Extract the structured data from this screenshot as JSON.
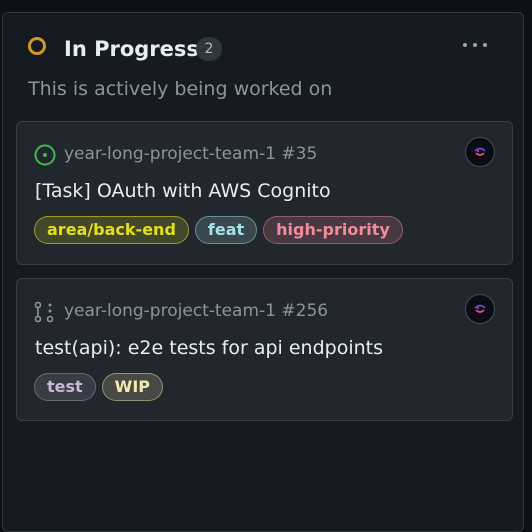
{
  "column": {
    "title": "In Progress",
    "count": "2",
    "description": "This is actively being worked on",
    "status_color": "#d29922"
  },
  "cards": [
    {
      "repo": "year-long-project-team-1 #35",
      "title": "[Task] OAuth with AWS Cognito",
      "type_icon": "issue-open-icon",
      "labels": [
        {
          "text": "area/back-end",
          "color": "#e3e11a"
        },
        {
          "text": "feat",
          "color": "#a6e2e9"
        },
        {
          "text": "high-priority",
          "color": "#f28b9c"
        }
      ]
    },
    {
      "repo": "year-long-project-team-1 #256",
      "title": "test(api): e2e tests for api endpoints",
      "type_icon": "draft-pull-request-icon",
      "labels": [
        {
          "text": "test",
          "color": "#c8b8d6"
        },
        {
          "text": "WIP",
          "color": "#f2eab1"
        }
      ]
    }
  ]
}
